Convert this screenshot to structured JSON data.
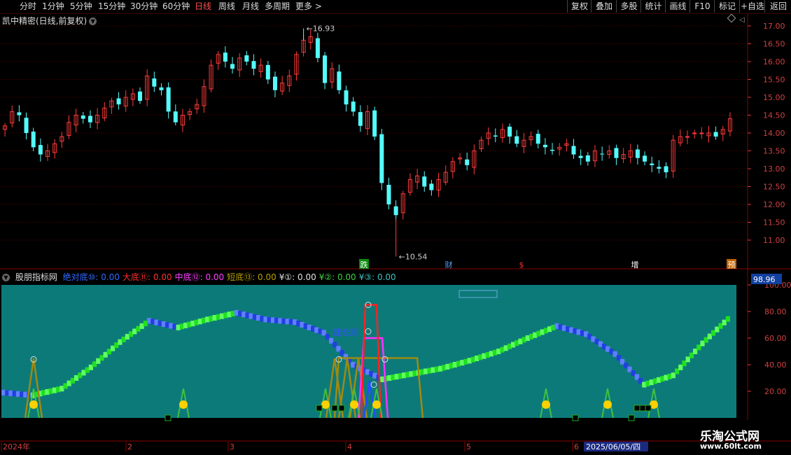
{
  "toolbar": {
    "periods": [
      "分时",
      "1分钟",
      "5分钟",
      "15分钟",
      "30分钟",
      "60分钟",
      "日线",
      "周线",
      "月线",
      "多周期",
      "更多 >"
    ],
    "active_period": "日线",
    "buttons": [
      "复权",
      "叠加",
      "多股",
      "统计",
      "画线",
      "F10",
      "标记",
      "+自选",
      "返回"
    ]
  },
  "stock": {
    "title": "凯中精密(日线,前复权)"
  },
  "markers": {
    "high_label": "16.93",
    "low_label": "10.54",
    "events": [
      "跌",
      "财",
      "$",
      "增",
      "预"
    ]
  },
  "indicator": {
    "name": "股朋指标网",
    "legend": [
      {
        "label": "绝对底⑩: 0.00",
        "color": "#2f6bff"
      },
      {
        "label": "大底⑪: 0.00",
        "color": "#ff3030"
      },
      {
        "label": "中底⑫: 0.00",
        "color": "#ff40ff"
      },
      {
        "label": "短底⑬: 0.00",
        "color": "#b8a000"
      },
      {
        "label": "¥①: 0.00",
        "color": "#e0e0e0"
      },
      {
        "label": "¥②: 0.00",
        "color": "#40d040"
      },
      {
        "label": "¥③: 0.00",
        "color": "#40c0c0"
      }
    ],
    "annotation": "建仓期",
    "current_value": "98.96"
  },
  "date_axis": {
    "labels": [
      "2024年",
      "2",
      "3",
      "4",
      "5",
      "6"
    ],
    "cursor_date": "2025/06/05/四"
  },
  "watermark": {
    "line1": "乐淘公式网",
    "line2": "www.60lt.com"
  },
  "colors": {
    "up": "#ff3c3c",
    "down": "#54fcfc",
    "panel_bg": "#0d7a7a",
    "grid": "#6a0000"
  },
  "chart_data": [
    {
      "type": "candlestick",
      "title": "凯中精密(日线,前复权)",
      "y_axis_ticks": [
        11.0,
        11.5,
        12.0,
        12.5,
        13.0,
        13.5,
        14.0,
        14.5,
        15.0,
        15.5,
        16.0,
        16.5,
        17.0
      ],
      "ylim": [
        10.2,
        17.3
      ],
      "high": 16.93,
      "low": 10.54,
      "close_series": [
        14.2,
        14.6,
        14.5,
        14.0,
        13.6,
        13.4,
        13.5,
        13.7,
        13.9,
        14.3,
        14.5,
        14.4,
        14.3,
        14.5,
        14.7,
        14.9,
        14.8,
        15.0,
        15.1,
        14.9,
        15.6,
        15.3,
        15.2,
        14.6,
        14.3,
        14.5,
        14.6,
        14.8,
        15.3,
        15.9,
        16.2,
        16.0,
        15.8,
        16.1,
        16.0,
        15.8,
        15.9,
        15.5,
        15.2,
        15.4,
        15.6,
        16.2,
        16.6,
        16.7,
        16.1,
        15.4,
        15.8,
        15.2,
        14.8,
        14.6,
        14.2,
        14.6,
        13.9,
        12.6,
        12.0,
        11.7,
        12.3,
        12.7,
        12.8,
        12.5,
        12.4,
        12.7,
        12.9,
        13.2,
        13.3,
        13.1,
        13.5,
        13.8,
        14.0,
        13.9,
        14.1,
        13.9,
        13.7,
        13.8,
        13.9,
        13.7,
        13.6,
        13.5,
        13.6,
        13.7,
        13.4,
        13.3,
        13.2,
        13.5,
        13.4,
        13.5,
        13.3,
        13.4,
        13.5,
        13.3,
        13.2,
        13.1,
        13.0,
        12.9,
        13.8,
        13.9,
        13.9,
        14.0,
        14.0,
        14.0,
        13.9,
        14.1,
        14.4
      ]
    },
    {
      "type": "line",
      "title": "股朋指标网",
      "y_axis_ticks": [
        20.0,
        40.0,
        60.0,
        80.0,
        100.0
      ],
      "ylim": [
        0,
        100
      ],
      "x": [
        0,
        10,
        20,
        30,
        40,
        50,
        60,
        70,
        80,
        90,
        100,
        110,
        120,
        130,
        140,
        150,
        160,
        170,
        180,
        190,
        200,
        212
      ],
      "series": [
        {
          "name": "main",
          "values": [
            19,
            17,
            22,
            38,
            57,
            73,
            68,
            74,
            79,
            74,
            72,
            64,
            40,
            29,
            33,
            37,
            43,
            50,
            60,
            69,
            63,
            48,
            25,
            32,
            56,
            77
          ]
        }
      ]
    }
  ]
}
